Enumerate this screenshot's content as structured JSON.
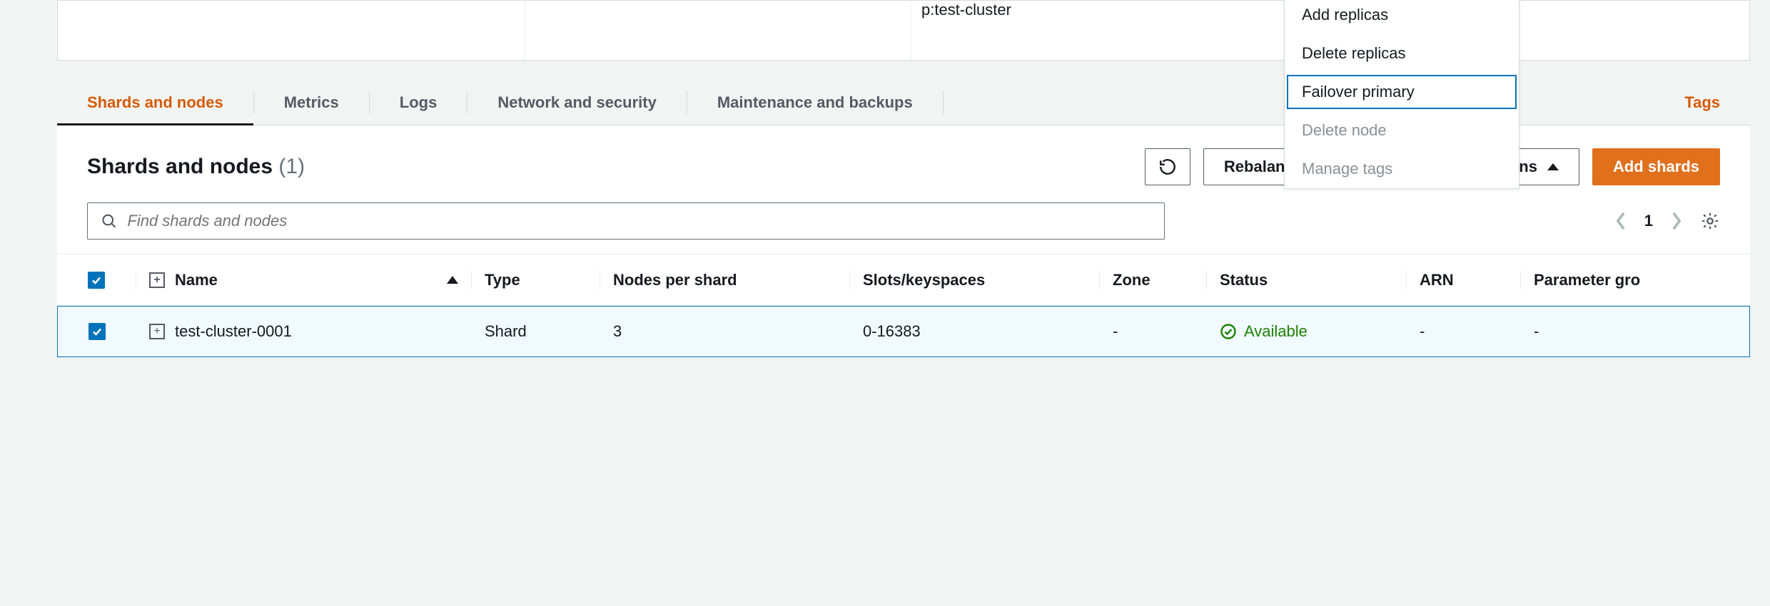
{
  "top_panel": {
    "cluster_label": "p:test-cluster"
  },
  "tabs": {
    "shards": "Shards and nodes",
    "metrics": "Metrics",
    "logs": "Logs",
    "network": "Network and security",
    "maintenance": "Maintenance and backups",
    "tags": "Tags"
  },
  "actions_menu": {
    "add_replicas": "Add replicas",
    "delete_replicas": "Delete replicas",
    "failover_primary": "Failover primary",
    "delete_node": "Delete node",
    "manage_tags": "Manage tags"
  },
  "panel": {
    "title": "Shards and nodes",
    "count": "(1)",
    "rebalance": "Rebalance slot distribution",
    "actions": "Actions",
    "add_shards": "Add shards"
  },
  "search": {
    "placeholder": "Find shards and nodes",
    "page": "1"
  },
  "columns": {
    "name": "Name",
    "type": "Type",
    "nodes": "Nodes per shard",
    "slots": "Slots/keyspaces",
    "zone": "Zone",
    "status": "Status",
    "arn": "ARN",
    "param": "Parameter gro"
  },
  "rows": [
    {
      "name": "test-cluster-0001",
      "type": "Shard",
      "nodes": "3",
      "slots": "0-16383",
      "zone": "-",
      "status": "Available",
      "arn": "-",
      "param": "-"
    }
  ]
}
